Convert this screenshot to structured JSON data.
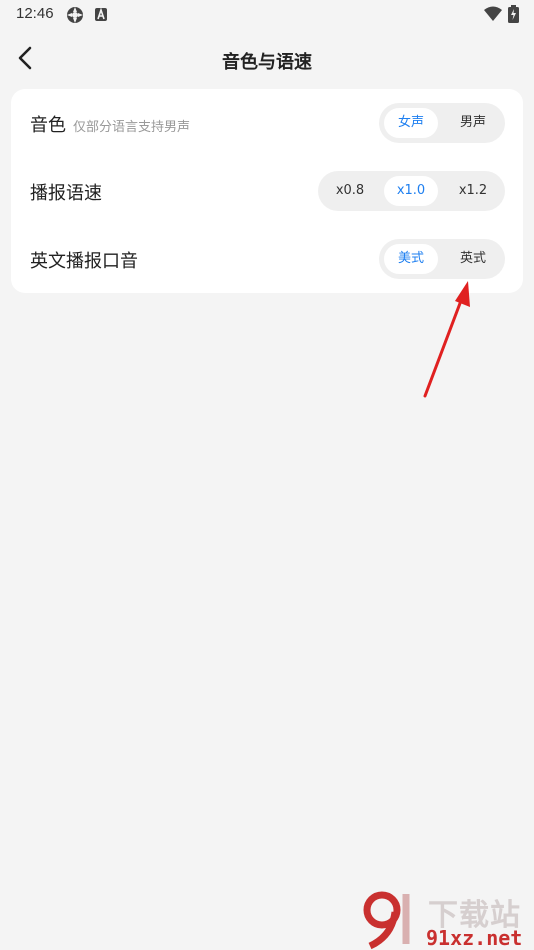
{
  "status_bar": {
    "time": "12:46",
    "icons": [
      "settings-icon",
      "a-badge-icon",
      "wifi-icon",
      "battery-icon"
    ]
  },
  "header": {
    "title": "音色与语速",
    "back_icon": "chevron-left-icon"
  },
  "settings": {
    "voice": {
      "label": "音色",
      "sublabel": "仅部分语言支持男声",
      "options": [
        "女声",
        "男声"
      ],
      "selected": "女声"
    },
    "speed": {
      "label": "播报语速",
      "options": [
        "x0.8",
        "x1.0",
        "x1.2"
      ],
      "selected": "x1.0"
    },
    "accent": {
      "label": "英文播报口音",
      "options": [
        "美式",
        "英式"
      ],
      "selected": "美式"
    }
  },
  "annotation": {
    "color": "#e02020",
    "icon": "red-arrow"
  },
  "watermark": {
    "text": "下载站",
    "url": "91xz.net",
    "color": "#c9302f"
  },
  "colors": {
    "accent": "#1e7ff0",
    "background": "#f4f4f4",
    "card": "#ffffff",
    "segment": "#efefef"
  }
}
